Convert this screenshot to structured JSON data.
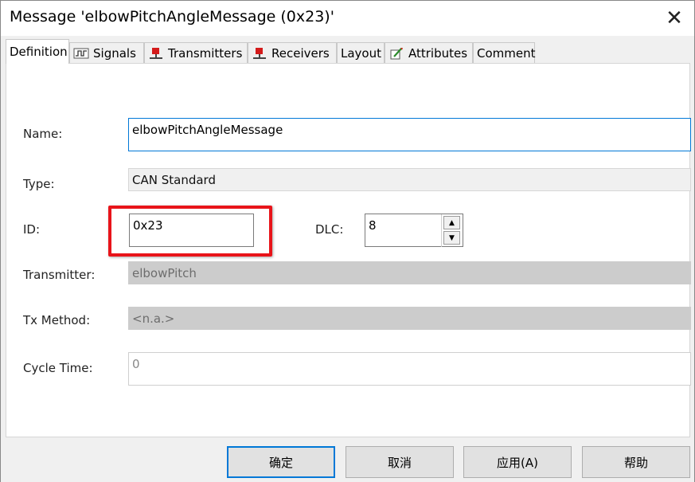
{
  "window": {
    "title": "Message 'elbowPitchAngleMessage (0x23)'",
    "close_glyph": "✕"
  },
  "tabs": [
    {
      "label": "Definition",
      "icon": ""
    },
    {
      "label": "Signals",
      "icon": "signals-icon"
    },
    {
      "label": "Transmitters",
      "icon": "transmitter-icon"
    },
    {
      "label": "Receivers",
      "icon": "receiver-icon"
    },
    {
      "label": "Layout",
      "icon": ""
    },
    {
      "label": "Attributes",
      "icon": "attributes-icon"
    },
    {
      "label": "Comment",
      "icon": ""
    }
  ],
  "form": {
    "name_label": "Name:",
    "name_value": "elbowPitchAngleMessage",
    "type_label": "Type:",
    "type_value": "CAN Standard",
    "id_label": "ID:",
    "id_value": "0x23",
    "dlc_label": "DLC:",
    "dlc_value": "8",
    "transmitter_label": "Transmitter:",
    "transmitter_value": "elbowPitch",
    "tx_method_label": "Tx Method:",
    "tx_method_value": "<n.a.>",
    "cycle_time_label": "Cycle Time:",
    "cycle_time_value": "0"
  },
  "footer": {
    "ok": "确定",
    "cancel": "取消",
    "apply": "应用(A)",
    "help": "帮助"
  },
  "colors": {
    "highlight": "#e8141a",
    "focus_border": "#0078d7"
  }
}
